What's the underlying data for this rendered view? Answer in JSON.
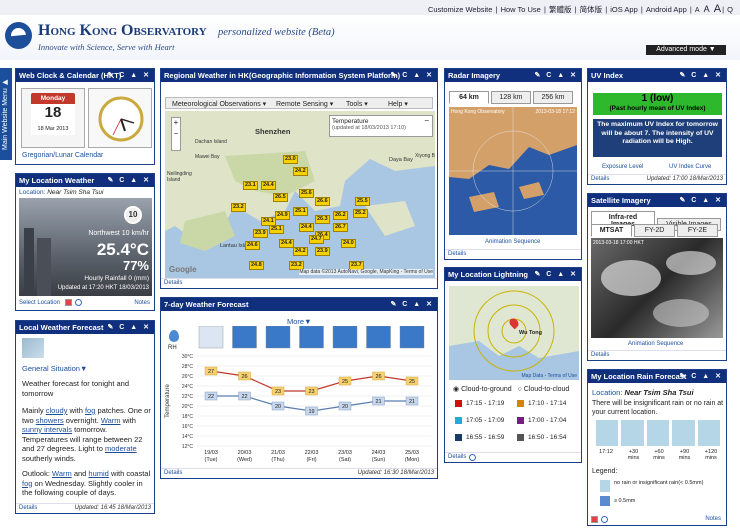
{
  "topbar": {
    "items": [
      "Customize Website",
      "How To Use",
      "繁體版",
      "简体版",
      "iOS App",
      "Android App"
    ],
    "font": [
      "A",
      "A",
      "A"
    ],
    "search": "Q"
  },
  "header": {
    "title": "Hong Kong Observatory",
    "subtitle": "personalized website (Beta)",
    "motto": "Innovate with Science, Serve with Heart",
    "advanced": "Advanced mode ▼"
  },
  "side_menu": "Main Website Menu ▶",
  "controls": "✎ C ▲ ✕",
  "clock": {
    "title": "Web Clock & Calendar (HKT)",
    "weekday": "Monday",
    "day": "18",
    "monthyear": "18 Mar 2013",
    "calendar_link": "Gregorian/Lunar Calendar"
  },
  "mylocation": {
    "title": "My Location Weather",
    "location_label": "Location:",
    "location": "Near Tsim Sha Tsui",
    "uv": "10",
    "wind": "Northwest 10 km/hr",
    "temp": "25.4°C",
    "humidity": "77%",
    "rain": "Hourly Rainfall 0 (mm)",
    "updated": "Updated at 17:20 HKT 18/03/2013",
    "select": "Select Location",
    "notes": "Notes"
  },
  "local_forecast": {
    "title": "Local Weather Forecast",
    "situation": "General Situation▼",
    "intro": "Weather forecast for tonight and tomorrow",
    "para1": [
      "Mainly ",
      "cloudy",
      " with ",
      "fog",
      " patches. One or two ",
      "showers",
      " overnight. ",
      "Warm",
      " with ",
      "sunny intervals",
      " tomorrow. Temperatures will range between 22 and 27 degrees. Light to ",
      "moderate",
      " southerly winds."
    ],
    "para2": [
      "Outlook: ",
      "Warm",
      " and ",
      "humid",
      " with coastal ",
      "fog",
      " on Wednesday. Slightly cooler in the following couple of days."
    ],
    "details": "Details",
    "updated": "Updated: 16:45 18/Mar/2013"
  },
  "regional": {
    "title": "Regional Weather in HK(Geographic Information System Platform)",
    "menus": [
      "Meteorological Observations ▾",
      "Remote Sensing ▾",
      "Tools ▾",
      "Help ▾"
    ],
    "popup_title": "Temperature",
    "popup_time": "(updated at 18/03/2013 17:10)",
    "places": [
      "Shenzhen",
      "Dachan Island",
      "Mawei Bay",
      "Lantau Island",
      "Daya Bay",
      "Xiyong B",
      "Neilingding Island"
    ],
    "temps": [
      "23.0",
      "24.2",
      "23.1",
      "24.4",
      "26.5",
      "23.2",
      "25.6",
      "26.6",
      "25.1",
      "24.9",
      "26.3",
      "26.2",
      "24.4",
      "25.1",
      "23.9",
      "24.6",
      "24.2",
      "23.2",
      "24.8",
      "26.4",
      "26.7",
      "23.9",
      "24.0",
      "23.7",
      "25.2",
      "25.5",
      "24.7",
      "24.4",
      "24.1"
    ],
    "credit": "Map data ©2013 AutoNavi, Google, MapKing - Terms of Use",
    "details": "Details",
    "google": "Google"
  },
  "radar": {
    "title": "Radar Imagery",
    "tabs": [
      "64 km",
      "128 km",
      "256 km"
    ],
    "stamp": "2013-03-18 17:12",
    "caption": "Hong Kong Observatory",
    "anim": "Animation Sequence",
    "details": "Details"
  },
  "uv": {
    "title": "UV Index",
    "value": "1 (low)",
    "sub": "(Past hourly mean of UV Index)",
    "max": "The maximum UV Index for tomorrow will be about 7. The intensity of UV radiation will be High.",
    "link1": "Exposure Level",
    "link2": "UV Index Curve",
    "details": "Details",
    "updated": "Updated: 17:00 18/Mar/2013"
  },
  "satellite": {
    "title": "Satellite Imagery",
    "tabs1": [
      "Infra-red Images",
      "Visible Images"
    ],
    "tabs2": [
      "MTSAT",
      "FY-2D",
      "FY-2E"
    ],
    "stamp": "2013-03-18 17:00 HKT",
    "anim": "Animation Sequence",
    "details": "Details"
  },
  "forecast7": {
    "title": "7-day Weather Forecast",
    "more": "More▼",
    "rh": "RH",
    "ylabel": "Temperature",
    "details": "Details",
    "updated": "Updated: 16:30 18/Mar/2013"
  },
  "lightning": {
    "title": "My Location Lightning",
    "place": "Wu Tong",
    "radio1": "Cloud-to-ground",
    "radio2": "Cloud-to-cloud",
    "credit": "Map Data - Terms of Use",
    "details": "Details",
    "legend": [
      {
        "t": "17:15 - 17:19",
        "c": "#cc1111"
      },
      {
        "t": "17:10 - 17:14",
        "c": "#d4820a"
      },
      {
        "t": "17:05 - 17:09",
        "c": "#22aadd"
      },
      {
        "t": "17:00 - 17:04",
        "c": "#7a1a8a"
      },
      {
        "t": "16:55 - 16:59",
        "c": "#1a3a6a"
      },
      {
        "t": "16:50 - 16:54",
        "c": "#555555"
      }
    ]
  },
  "rain": {
    "title": "My Location Rain Forecast",
    "location_label": "Location:",
    "location": "Near Tsim Sha Tsui",
    "msg": "There will be insignificant rain or no rain at your current location.",
    "times": [
      "17:12",
      "+30 mins",
      "+60 mins",
      "+90 mins",
      "+120 mins"
    ],
    "legend": "Legend:",
    "leg1": "no rain or insignificant rain(< 0.5mm)",
    "leg2": "≥ 0.5mm",
    "notes": "Notes"
  },
  "chart_data": {
    "type": "line",
    "categories": [
      "19/03 (Tue)",
      "20/03 (Wed)",
      "21/03 (Thu)",
      "22/03 (Fri)",
      "23/03 (Sat)",
      "24/03 (Sun)",
      "25/03 (Mon)"
    ],
    "series": [
      {
        "values": [
          27,
          26,
          23,
          23,
          25,
          26,
          25
        ],
        "color": "#c0392b"
      },
      {
        "values": [
          22,
          22,
          20,
          19,
          20,
          21,
          21
        ],
        "color": "#5a7db0"
      }
    ],
    "yticks": [
      "30°C",
      "28°C",
      "26°C",
      "24°C",
      "22°C",
      "20°C",
      "18°C",
      "16°C",
      "14°C",
      "12°C"
    ],
    "ylim": [
      12,
      30
    ],
    "ylabel": "Temperature"
  }
}
